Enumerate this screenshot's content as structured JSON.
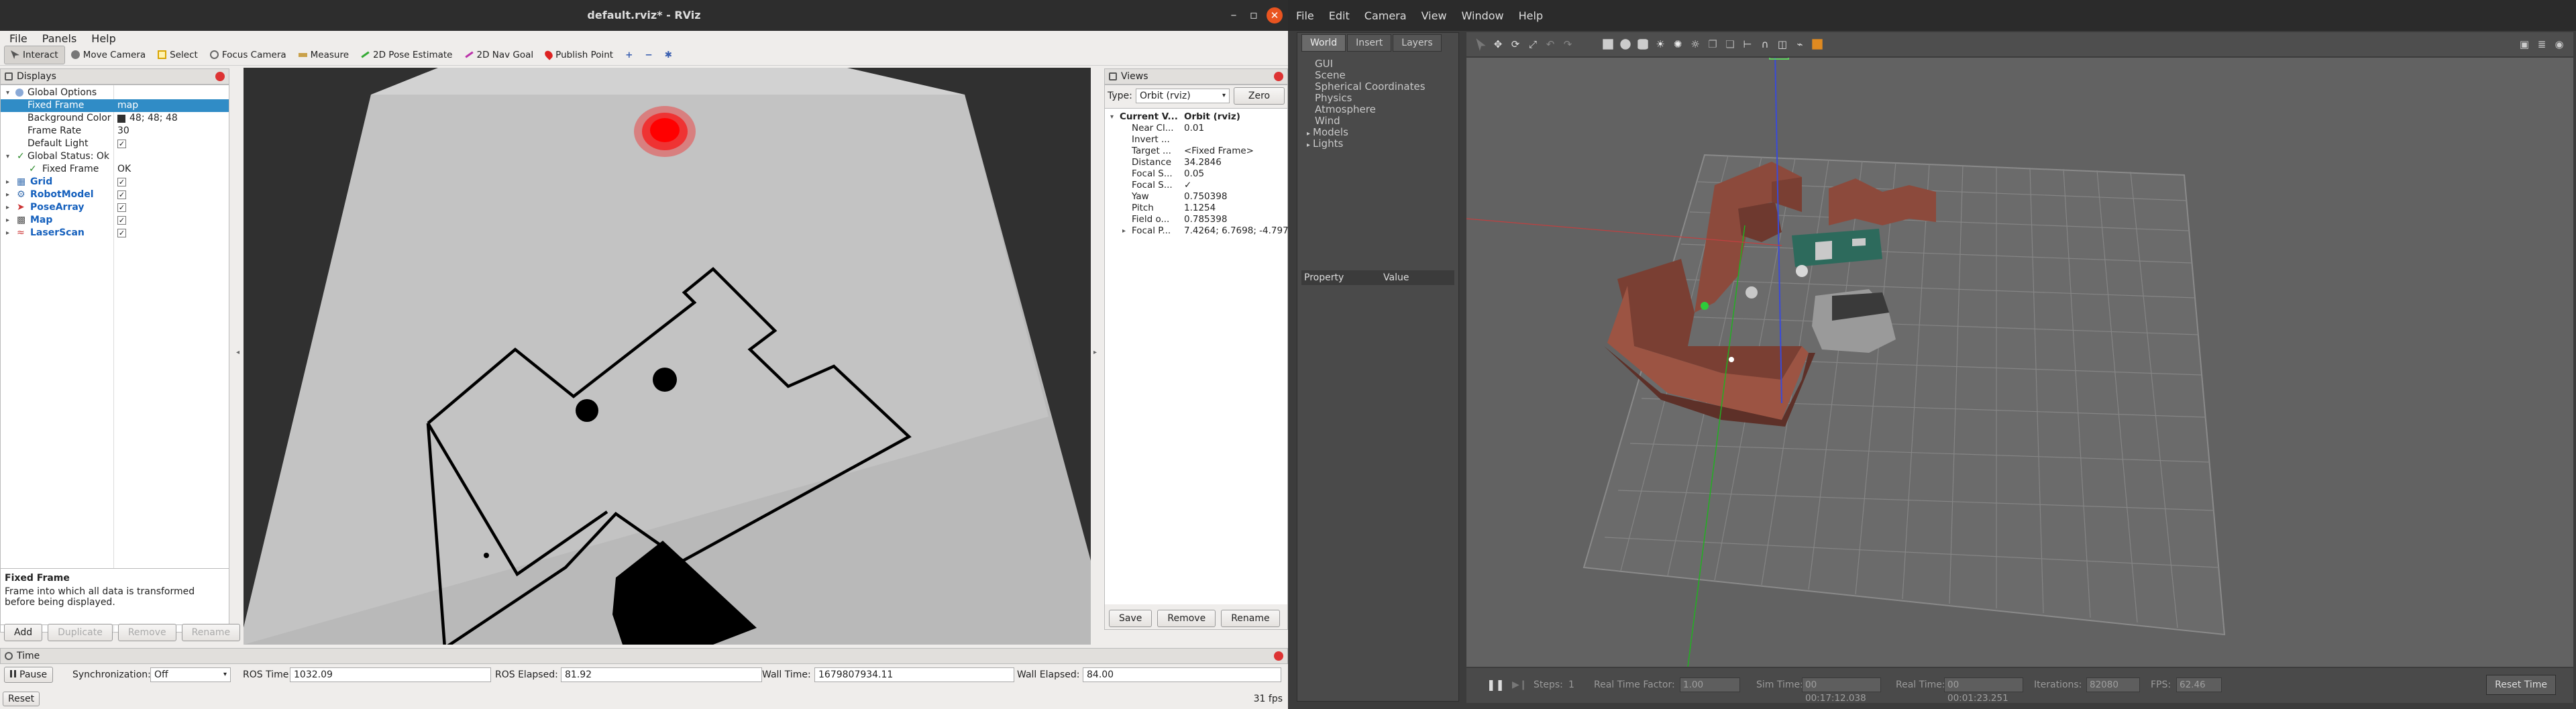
{
  "rviz": {
    "window_title": "default.rviz* - RViz",
    "menu": [
      "File",
      "Panels",
      "Help"
    ],
    "tools": [
      "Interact",
      "Move Camera",
      "Select",
      "Focus Camera",
      "Measure",
      "2D Pose Estimate",
      "2D Nav Goal",
      "Publish Point"
    ],
    "displays": {
      "title": "Displays",
      "rows": [
        {
          "name": "Global Options",
          "value": ""
        },
        {
          "name": "Fixed Frame",
          "value": "map"
        },
        {
          "name": "Background Color",
          "value": "48; 48; 48"
        },
        {
          "name": "Frame Rate",
          "value": "30"
        },
        {
          "name": "Default Light",
          "value": ""
        },
        {
          "name": "Global Status: Ok",
          "value": ""
        },
        {
          "name": "Fixed Frame",
          "value": "OK"
        },
        {
          "name": "Grid",
          "value": ""
        },
        {
          "name": "RobotModel",
          "value": ""
        },
        {
          "name": "PoseArray",
          "value": ""
        },
        {
          "name": "Map",
          "value": ""
        },
        {
          "name": "LaserScan",
          "value": ""
        }
      ],
      "desc_title": "Fixed Frame",
      "desc_text": "Frame into which all data is transformed before being displayed.",
      "buttons": [
        "Add",
        "Duplicate",
        "Remove",
        "Rename"
      ]
    },
    "views": {
      "title": "Views",
      "type_label": "Type:",
      "type_value": "Orbit (rviz)",
      "zero_label": "Zero",
      "rows": [
        {
          "name": "Current V...",
          "value": "Orbit (rviz)"
        },
        {
          "name": "Near Cl...",
          "value": "0.01"
        },
        {
          "name": "Invert ...",
          "value": ""
        },
        {
          "name": "Target ...",
          "value": "<Fixed Frame>"
        },
        {
          "name": "Distance",
          "value": "34.2846"
        },
        {
          "name": "Focal S...",
          "value": "0.05"
        },
        {
          "name": "Focal S...",
          "value": "✓"
        },
        {
          "name": "Yaw",
          "value": "0.750398"
        },
        {
          "name": "Pitch",
          "value": "1.1254"
        },
        {
          "name": "Field o...",
          "value": "0.785398"
        },
        {
          "name": "Focal P...",
          "value": "7.4264; 6.7698; -4.797"
        }
      ],
      "buttons": [
        "Save",
        "Remove",
        "Rename"
      ]
    },
    "time": {
      "title": "Time",
      "pause_label": "Pause",
      "sync_label": "Synchronization:",
      "sync_value": "Off",
      "ros_time_label": "ROS Time:",
      "ros_time": "1032.09",
      "ros_elapsed_label": "ROS Elapsed:",
      "ros_elapsed": "81.92",
      "wall_time_label": "Wall Time:",
      "wall_time": "1679807934.11",
      "wall_elapsed_label": "Wall Elapsed:",
      "wall_elapsed": "84.00"
    },
    "status": {
      "reset_label": "Reset",
      "fps": "31 fps"
    }
  },
  "gazebo": {
    "menu": [
      "File",
      "Edit",
      "Camera",
      "View",
      "Window",
      "Help"
    ],
    "tabs": [
      "World",
      "Insert",
      "Layers"
    ],
    "world_tree": [
      "GUI",
      "Scene",
      "Spherical Coordinates",
      "Physics",
      "Atmosphere",
      "Wind",
      "Models",
      "Lights"
    ],
    "property_header": "Property",
    "value_header": "Value",
    "bottom": {
      "steps_label": "Steps:",
      "steps_value": "1",
      "rtf_label": "Real Time Factor:",
      "rtf_value": "1.00",
      "sim_time_label": "Sim Time:",
      "sim_time": "00 00:17:12.038",
      "real_time_label": "Real Time:",
      "real_time": "00 00:01:23.251",
      "iterations_label": "Iterations:",
      "iterations": "82080",
      "fps_label": "FPS:",
      "fps": "62.46",
      "reset_label": "Reset Time"
    }
  }
}
